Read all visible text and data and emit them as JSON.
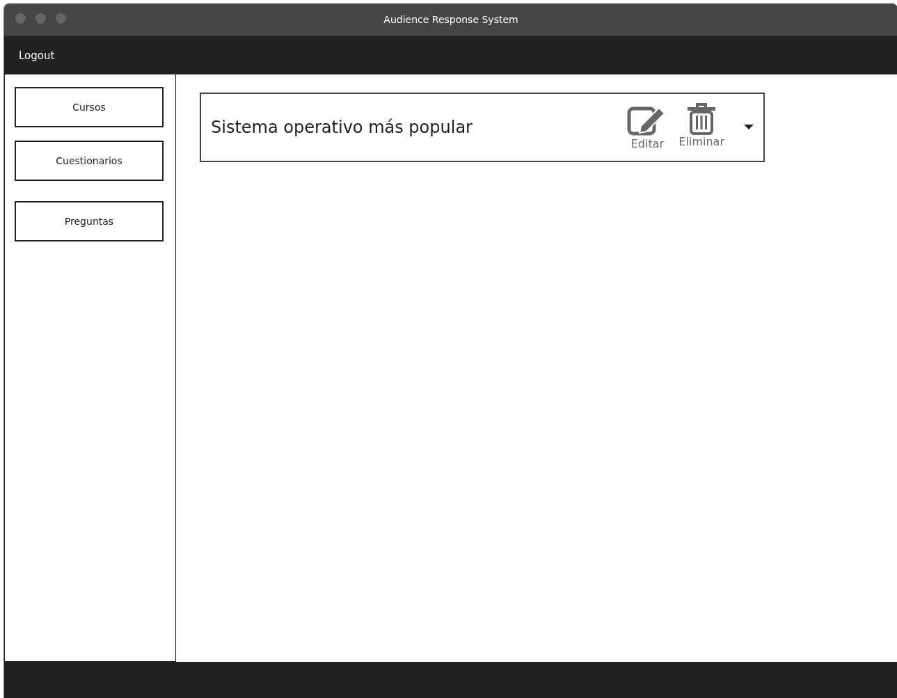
{
  "window": {
    "title": "Audience Response System"
  },
  "menu_bar": {
    "logout": "Logout"
  },
  "sidebar": {
    "items": [
      {
        "label": "Cursos"
      },
      {
        "label": "Cuestionarios"
      },
      {
        "label": "Preguntas"
      }
    ]
  },
  "questions": [
    {
      "title": "Sistema operativo más popular",
      "edit_label": "Editar",
      "delete_label": "Eliminar"
    }
  ]
}
